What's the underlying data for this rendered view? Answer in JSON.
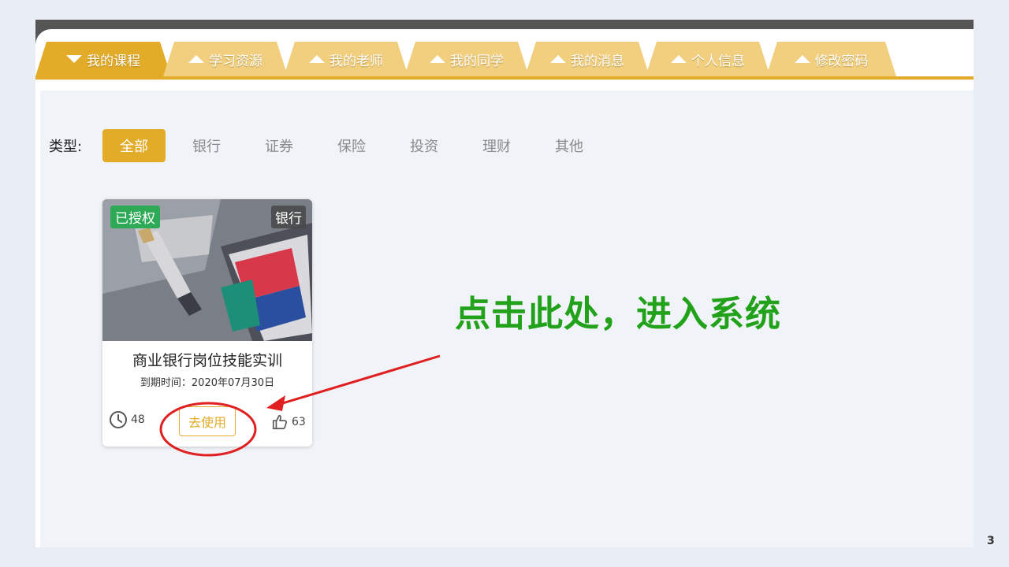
{
  "tabs": [
    {
      "label": "我的课程",
      "active": true
    },
    {
      "label": "学习资源",
      "active": false
    },
    {
      "label": "我的老师",
      "active": false
    },
    {
      "label": "我的同学",
      "active": false
    },
    {
      "label": "我的消息",
      "active": false
    },
    {
      "label": "个人信息",
      "active": false
    },
    {
      "label": "修改密码",
      "active": false
    }
  ],
  "filter": {
    "label": "类型:",
    "options": [
      "全部",
      "银行",
      "证券",
      "保险",
      "投资",
      "理财",
      "其他"
    ],
    "selected": "全部"
  },
  "course_card": {
    "auth_badge": "已授权",
    "type_badge": "银行",
    "title": "商业银行岗位技能实训",
    "expire": "到期时间：2020年07月30日",
    "views": "48",
    "use_button": "去使用",
    "likes": "63"
  },
  "annotation": {
    "text": "点击此处，进入系统",
    "color": "#22a21a",
    "circle_color": "#e02020"
  },
  "page_number": "3",
  "colors": {
    "accent": "#e2ab28",
    "tab_inactive": "#f1cf7e",
    "auth_green": "#2eaa56"
  }
}
